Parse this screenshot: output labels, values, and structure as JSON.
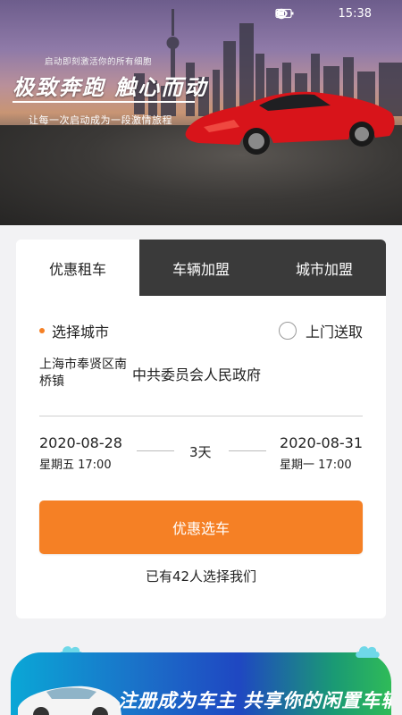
{
  "status_bar": {
    "time": "15:38",
    "icons": [
      "eye-icon",
      "alarm-icon",
      "battery-icon"
    ]
  },
  "hero": {
    "subtitle": "启动即刻激活你的所有细胞",
    "title": "极致奔跑  触心而动",
    "tagline": "让每一次启动成为一段激情旅程"
  },
  "tabs": [
    {
      "label": "优惠租车",
      "active": true
    },
    {
      "label": "车辆加盟",
      "active": false
    },
    {
      "label": "城市加盟",
      "active": false
    }
  ],
  "booking": {
    "city_label": "选择城市",
    "pickup_label": "上门送取",
    "district": "上海市奉贤区南桥镇",
    "place": "中共委员会人民政府",
    "start": {
      "date": "2020-08-28",
      "weekday_time": "星期五 17:00"
    },
    "end": {
      "date": "2020-08-31",
      "weekday_time": "星期一 17:00"
    },
    "duration": "3天",
    "cta_label": "优惠选车",
    "count_text": "已有42人选择我们"
  },
  "banner": {
    "text": "注册成为车主  共享你的闲置车辆"
  },
  "colors": {
    "accent": "#f58025",
    "tab_dark": "#3a3a3a",
    "car_red": "#d8141a"
  }
}
